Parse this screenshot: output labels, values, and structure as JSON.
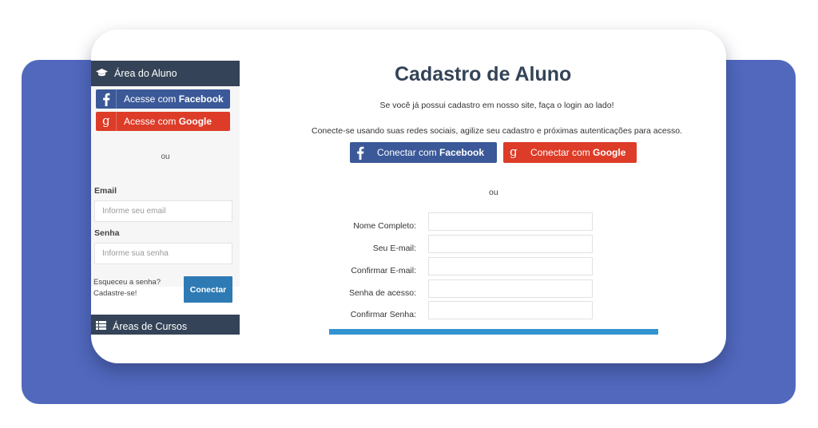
{
  "sidebar": {
    "student_area_title": "Área do Aluno",
    "facebook_btn": {
      "prefix": "Acesse com ",
      "brand": "Facebook"
    },
    "google_btn": {
      "prefix": "Acesse com ",
      "brand": "Google"
    },
    "or_label": "ou",
    "email_label": "Email",
    "email_placeholder": "Informe seu email",
    "password_label": "Senha",
    "password_placeholder": "Informe sua senha",
    "forgot_link": "Esqueceu a senha?",
    "register_link": "Cadastre-se!",
    "connect_button": "Conectar",
    "courses_title": "Áreas de Cursos"
  },
  "main": {
    "title": "Cadastro de Aluno",
    "login_hint": "Se você já possui cadastro em nosso site, faça o login ao lado!",
    "social_hint": "Conecte-se usando suas redes sociais, agilize seu cadastro e próximas autenticações para acesso.",
    "facebook_btn": {
      "prefix": "Conectar com ",
      "brand": "Facebook"
    },
    "google_btn": {
      "prefix": "Conectar com ",
      "brand": "Google"
    },
    "or_label": "ou",
    "fields": [
      {
        "label": "Nome Completo:",
        "value": ""
      },
      {
        "label": "Seu E-mail:",
        "value": ""
      },
      {
        "label": "Confirmar E-mail:",
        "value": ""
      },
      {
        "label": "Senha de acesso:",
        "value": ""
      },
      {
        "label": "Confirmar Senha:",
        "value": ""
      }
    ]
  },
  "icons": {
    "student_area": "graduation-cap-icon",
    "courses": "list-icon",
    "facebook": "facebook-icon",
    "google": "google-icon"
  },
  "colors": {
    "background_band": "#5168bd",
    "sidebar_header": "#344357",
    "facebook": "#3b5998",
    "google": "#dd3c28",
    "connect_button": "#2e7ab4",
    "submit_bar": "#3194d0",
    "title": "#344357"
  }
}
